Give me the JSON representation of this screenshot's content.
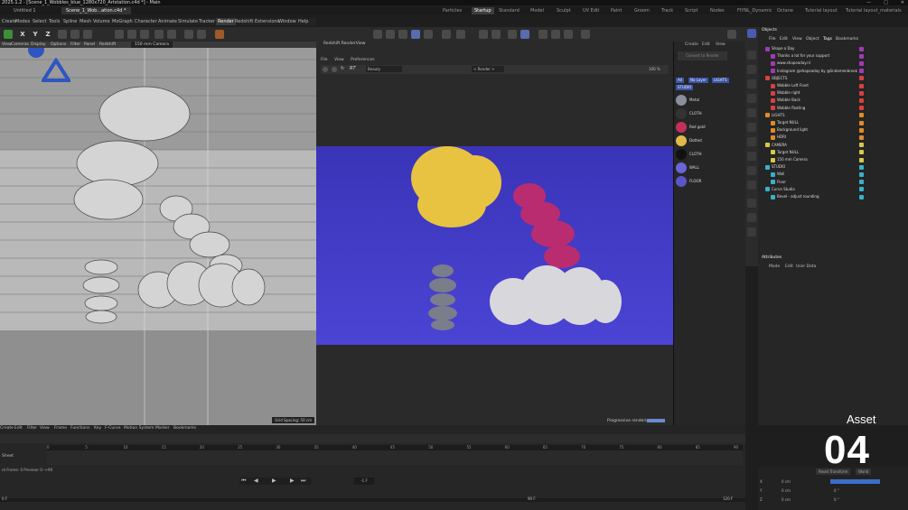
{
  "window": {
    "title": "2025.1.2 - [Scene_1_Wobbles_blue_1280x720_Artstation.c4d *] - Main",
    "tabs": [
      "Untitled 1",
      "Scene_1_Wob...ation.c4d *"
    ],
    "active_tab": 1
  },
  "layouts": {
    "items": [
      "Particles",
      "Startup",
      "Standard",
      "Model",
      "Sculpt",
      "UV Edit",
      "Paint",
      "Groom",
      "Track",
      "Script",
      "Nodes",
      "FIYNL_Dynamic",
      "Octane",
      "Tutorial layout",
      "Tutorial layout_materials"
    ],
    "active": "Startup"
  },
  "menubar": {
    "items": [
      "Create",
      "Modes",
      "Select",
      "Tools",
      "Spline",
      "Mesh",
      "Volume",
      "MoGraph",
      "Character",
      "Animate",
      "Simulate",
      "Tracker",
      "Render",
      "Redshift",
      "Extensions",
      "Window",
      "Help"
    ],
    "active": "Render"
  },
  "toolbar": {
    "axes": [
      "X",
      "Y",
      "Z"
    ]
  },
  "viewport": {
    "menu": [
      "View",
      "Cameras",
      "Display",
      "Options",
      "Filter",
      "Panel",
      "Redshift"
    ],
    "camera_label": "150 mm Camera",
    "grid_spacing": "Grid Spacing: 50 cm"
  },
  "renderview": {
    "title": "Redshift RenderView",
    "menu": [
      "File",
      "View",
      "Preferences"
    ],
    "mode": "Beauty",
    "render_target": "< Render >",
    "zoom": "100 %",
    "status": "Progressive rendering..."
  },
  "materials": {
    "header": [
      "Create",
      "Edit",
      "View"
    ],
    "button": "Convert to Render",
    "filters": [
      "All",
      "No Layer",
      "LIGHTS",
      "STUDIO"
    ],
    "items": [
      {
        "name": "Metal",
        "color": "#8b8f99"
      },
      {
        "name": "CLOTH",
        "color": "#333333"
      },
      {
        "name": "Red gold",
        "color": "#c2305a"
      },
      {
        "name": "Dotted",
        "color": "#e1b84b"
      },
      {
        "name": "CLOTH",
        "color": "#111111"
      },
      {
        "name": "WALL",
        "color": "#6a66d8"
      },
      {
        "name": "FLOOR",
        "color": "#5a56c8"
      }
    ]
  },
  "objects": {
    "title": "Objects",
    "menu": [
      "File",
      "Edit",
      "View",
      "Object",
      "Tags",
      "Bookmarks"
    ],
    "rows": [
      {
        "name": "Shape a Day",
        "level": 0,
        "tag": "#a03bb5"
      },
      {
        "name": "Thanks a lot  for your support",
        "level": 1,
        "tag": "#a03bb5"
      },
      {
        "name": "www.shapeaday.nl",
        "level": 1,
        "tag": "#a03bb5"
      },
      {
        "name": "Instagram @shapeaday by @lindamenbroek",
        "level": 1,
        "tag": "#a03bb5"
      },
      {
        "name": "OBJECTS",
        "level": 0,
        "tag": "#d84040"
      },
      {
        "name": "Wobble Left Front",
        "level": 1,
        "tag": "#d84040"
      },
      {
        "name": "Wobble right",
        "level": 1,
        "tag": "#d84040"
      },
      {
        "name": "Wobble Back",
        "level": 1,
        "tag": "#d84040"
      },
      {
        "name": "Wobble floating",
        "level": 1,
        "tag": "#d84040"
      },
      {
        "name": "LIGHTS",
        "level": 0,
        "tag": "#e08a2a"
      },
      {
        "name": "Target NULL",
        "level": 1,
        "tag": "#e08a2a"
      },
      {
        "name": "Background light",
        "level": 1,
        "tag": "#e08a2a"
      },
      {
        "name": "HDRI",
        "level": 1,
        "tag": "#e08a2a"
      },
      {
        "name": "CAMERA",
        "level": 0,
        "tag": "#d8c84a"
      },
      {
        "name": "Target NULL",
        "level": 1,
        "tag": "#d8c84a"
      },
      {
        "name": "150 mm Camera",
        "level": 1,
        "tag": "#d8c84a"
      },
      {
        "name": "STUDIO",
        "level": 0,
        "tag": "#3ab0c8"
      },
      {
        "name": "Wall",
        "level": 1,
        "tag": "#3ab0c8"
      },
      {
        "name": "Floor",
        "level": 1,
        "tag": "#3ab0c8"
      },
      {
        "name": "Curve Studio",
        "level": 0,
        "tag": "#3ab0c8"
      },
      {
        "name": "Bevel - adjust rounding",
        "level": 1,
        "tag": "#3ab0c8"
      }
    ]
  },
  "attributes": {
    "title": "Attributes",
    "menu": [
      "Mode",
      "Edit",
      "User Data"
    ]
  },
  "timeline": {
    "menu": [
      "Create",
      "Edit",
      "Filter",
      "View",
      "Frame",
      "Functions",
      "Key",
      "F-Curve",
      "Motion System",
      "Marker",
      "Bookmarks"
    ],
    "sheet_label": "Sheet",
    "status": "nt Frame: 0  Preview: 0-->90",
    "ticks": [
      "0",
      "5",
      "10",
      "15",
      "20",
      "25",
      "30",
      "35",
      "40",
      "45",
      "50",
      "55",
      "60",
      "65",
      "70",
      "75",
      "80",
      "85",
      "90"
    ],
    "current_frame": "-1 F",
    "start": "0 F",
    "end": "90 F",
    "max": "120 F"
  },
  "coords": {
    "labels": [
      "X",
      "Y",
      "Z"
    ],
    "values": [
      "0 cm",
      "0 cm",
      "0 cm"
    ],
    "angles": [
      "0 °",
      "0 °",
      "0 °"
    ],
    "dropdowns": [
      "Reset Transform",
      "World"
    ]
  },
  "overlay": {
    "label": "Asset",
    "number": "04"
  }
}
